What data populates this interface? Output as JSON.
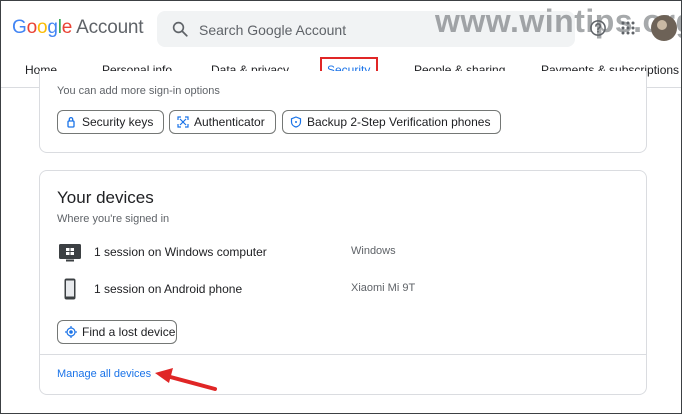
{
  "watermark": "www.wintips.org",
  "header": {
    "logo": {
      "g1": "G",
      "o1": "o",
      "o2": "o",
      "g2": "g",
      "l": "l",
      "e": "e",
      "product": "Account"
    },
    "search": {
      "placeholder": "Search Google Account"
    }
  },
  "nav": {
    "tabs": [
      {
        "label": "Home"
      },
      {
        "label": "Personal info"
      },
      {
        "label": "Data & privacy"
      },
      {
        "label": "Security"
      },
      {
        "label": "People & sharing"
      },
      {
        "label": "Payments & subscriptions"
      }
    ]
  },
  "signin": {
    "text": "You can add more sign-in options",
    "options": [
      {
        "label": "Security keys",
        "icon": "security-key-icon"
      },
      {
        "label": "Authenticator",
        "icon": "authenticator-icon"
      },
      {
        "label": "Backup 2-Step Verification phones",
        "icon": "shield-icon"
      }
    ]
  },
  "devices": {
    "title": "Your devices",
    "subtitle": "Where you're signed in",
    "items": [
      {
        "name": "1 session on Windows computer",
        "model": "Windows",
        "icon": "windows-computer-icon"
      },
      {
        "name": "1 session on Android phone",
        "model": "Xiaomi Mi 9T",
        "icon": "phone-icon"
      }
    ],
    "find_button": "Find a lost device",
    "manage_link": "Manage all devices"
  },
  "colors": {
    "accent": "#1a73e8",
    "highlight": "#e02626"
  }
}
